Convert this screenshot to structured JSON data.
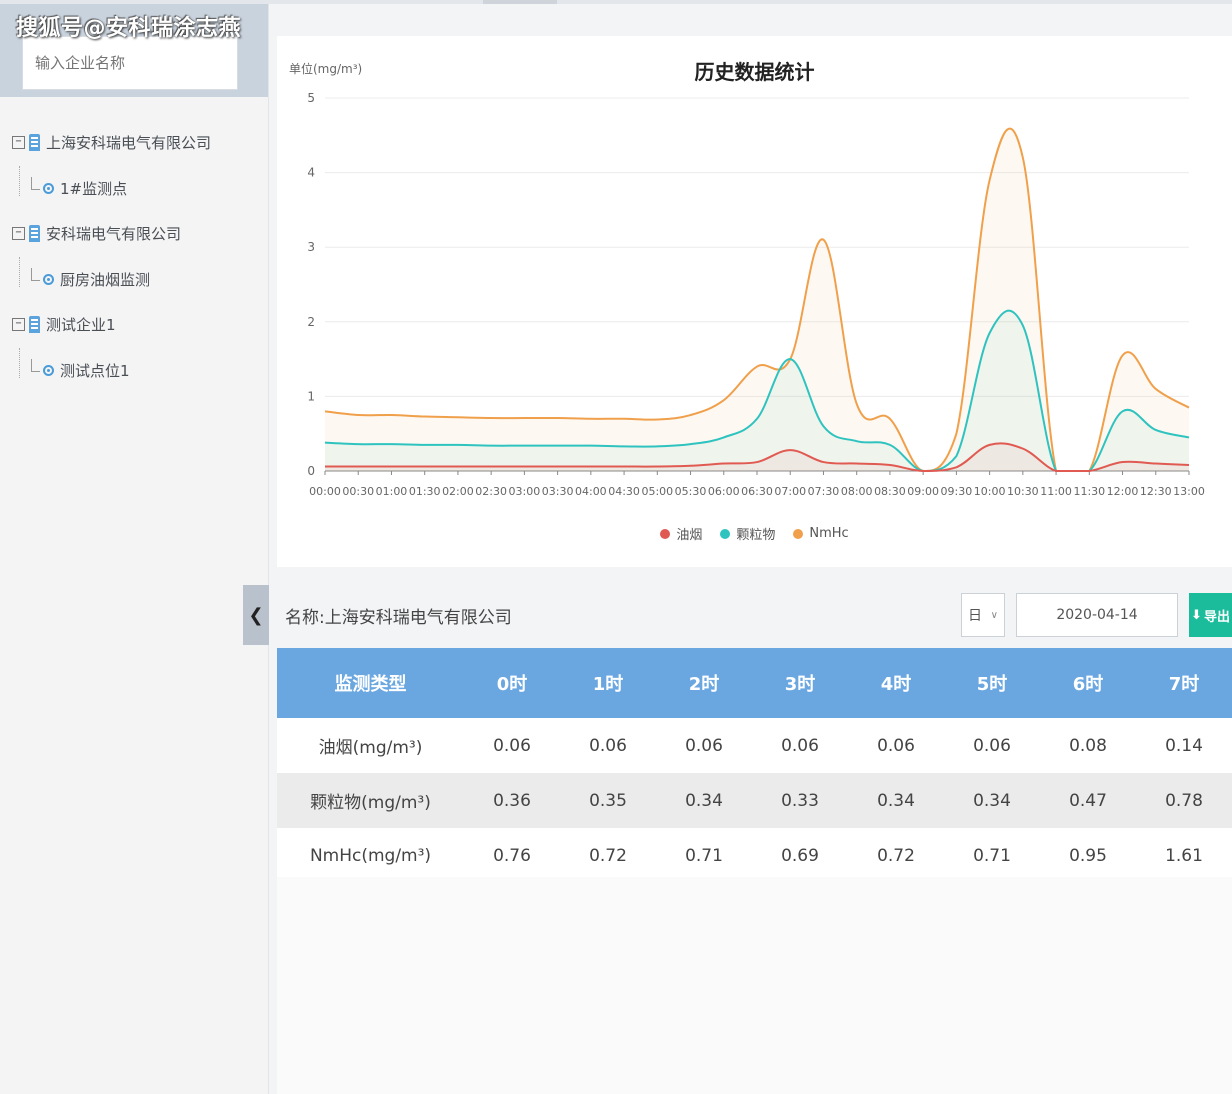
{
  "watermark": "搜狐号@安科瑞涂志燕",
  "sidebar": {
    "search_placeholder": "输入企业名称",
    "tree": [
      {
        "label": "上海安科瑞电气有限公司",
        "type": "folder"
      },
      {
        "label": "1#监测点",
        "type": "leaf"
      },
      {
        "label": "安科瑞电气有限公司",
        "type": "folder"
      },
      {
        "label": "厨房油烟监测",
        "type": "leaf"
      },
      {
        "label": "测试企业1",
        "type": "folder"
      },
      {
        "label": "测试点位1",
        "type": "leaf"
      }
    ],
    "collapse_icon": "chevron-left-icon"
  },
  "chart": {
    "title": "历史数据统计",
    "unit": "单位(mg/m³)",
    "legend": [
      {
        "name": "油烟",
        "color": "#e05a52"
      },
      {
        "name": "颗粒物",
        "color": "#2fc3bf"
      },
      {
        "name": "NmHc",
        "color": "#f0a04b"
      }
    ]
  },
  "chart_data": {
    "type": "area",
    "title": "历史数据统计",
    "ylabel": "单位(mg/m³)",
    "ylim": [
      0,
      5
    ],
    "yticks": [
      0,
      1,
      2,
      3,
      4,
      5
    ],
    "x": [
      "00:00",
      "00:30",
      "01:00",
      "01:30",
      "02:00",
      "02:30",
      "03:00",
      "03:30",
      "04:00",
      "04:30",
      "05:00",
      "05:30",
      "06:00",
      "06:30",
      "07:00",
      "07:30",
      "08:00",
      "08:30",
      "09:00",
      "09:30",
      "10:00",
      "10:30",
      "11:00",
      "11:30",
      "12:00",
      "12:30",
      "13:00"
    ],
    "xticks": [
      "00:00",
      "00:30",
      "01:00",
      "01:30",
      "02:00",
      "02:30",
      "03:00",
      "03:30",
      "04:00",
      "04:30",
      "05:00",
      "05:30",
      "06:00",
      "06:30",
      "07:00",
      "07:30",
      "08:00",
      "08:30",
      "09:00",
      "09:30",
      "10:00",
      "10:30",
      "11:00",
      "11:30",
      "12:00",
      "12:30",
      "13:00"
    ],
    "series": [
      {
        "name": "油烟",
        "color": "#e05a52",
        "values": [
          0.06,
          0.06,
          0.06,
          0.06,
          0.06,
          0.06,
          0.06,
          0.06,
          0.06,
          0.06,
          0.06,
          0.07,
          0.1,
          0.12,
          0.28,
          0.12,
          0.1,
          0.08,
          0,
          0.05,
          0.35,
          0.3,
          0,
          0,
          0.12,
          0.1,
          0.08
        ]
      },
      {
        "name": "颗粒物",
        "color": "#2fc3bf",
        "values": [
          0.38,
          0.36,
          0.36,
          0.35,
          0.35,
          0.34,
          0.34,
          0.34,
          0.34,
          0.33,
          0.33,
          0.36,
          0.45,
          0.7,
          1.5,
          0.6,
          0.4,
          0.35,
          0,
          0.2,
          1.85,
          1.95,
          0,
          0,
          0.8,
          0.55,
          0.45
        ]
      },
      {
        "name": "NmHc",
        "color": "#f0a04b",
        "values": [
          0.8,
          0.75,
          0.75,
          0.73,
          0.72,
          0.71,
          0.71,
          0.71,
          0.7,
          0.7,
          0.69,
          0.75,
          0.95,
          1.4,
          1.5,
          3.1,
          0.9,
          0.7,
          0,
          0.5,
          3.9,
          4.2,
          0,
          0,
          1.55,
          1.1,
          0.85
        ]
      }
    ]
  },
  "toolbar": {
    "station_label": "名称:上海安科瑞电气有限公司",
    "period_value": "日",
    "period_chevron": "chevron-down-icon",
    "date_value": "2020-04-14",
    "export_icon": "download-icon",
    "export_label": "导出"
  },
  "table": {
    "headers": [
      "监测类型",
      "0时",
      "1时",
      "2时",
      "3时",
      "4时",
      "5时",
      "6时",
      "7时"
    ],
    "rows": [
      [
        "油烟(mg/m³)",
        "0.06",
        "0.06",
        "0.06",
        "0.06",
        "0.06",
        "0.06",
        "0.08",
        "0.14"
      ],
      [
        "颗粒物(mg/m³)",
        "0.36",
        "0.35",
        "0.34",
        "0.33",
        "0.34",
        "0.34",
        "0.47",
        "0.78"
      ],
      [
        "NmHc(mg/m³)",
        "0.76",
        "0.72",
        "0.71",
        "0.69",
        "0.72",
        "0.71",
        "0.95",
        "1.61"
      ]
    ]
  }
}
